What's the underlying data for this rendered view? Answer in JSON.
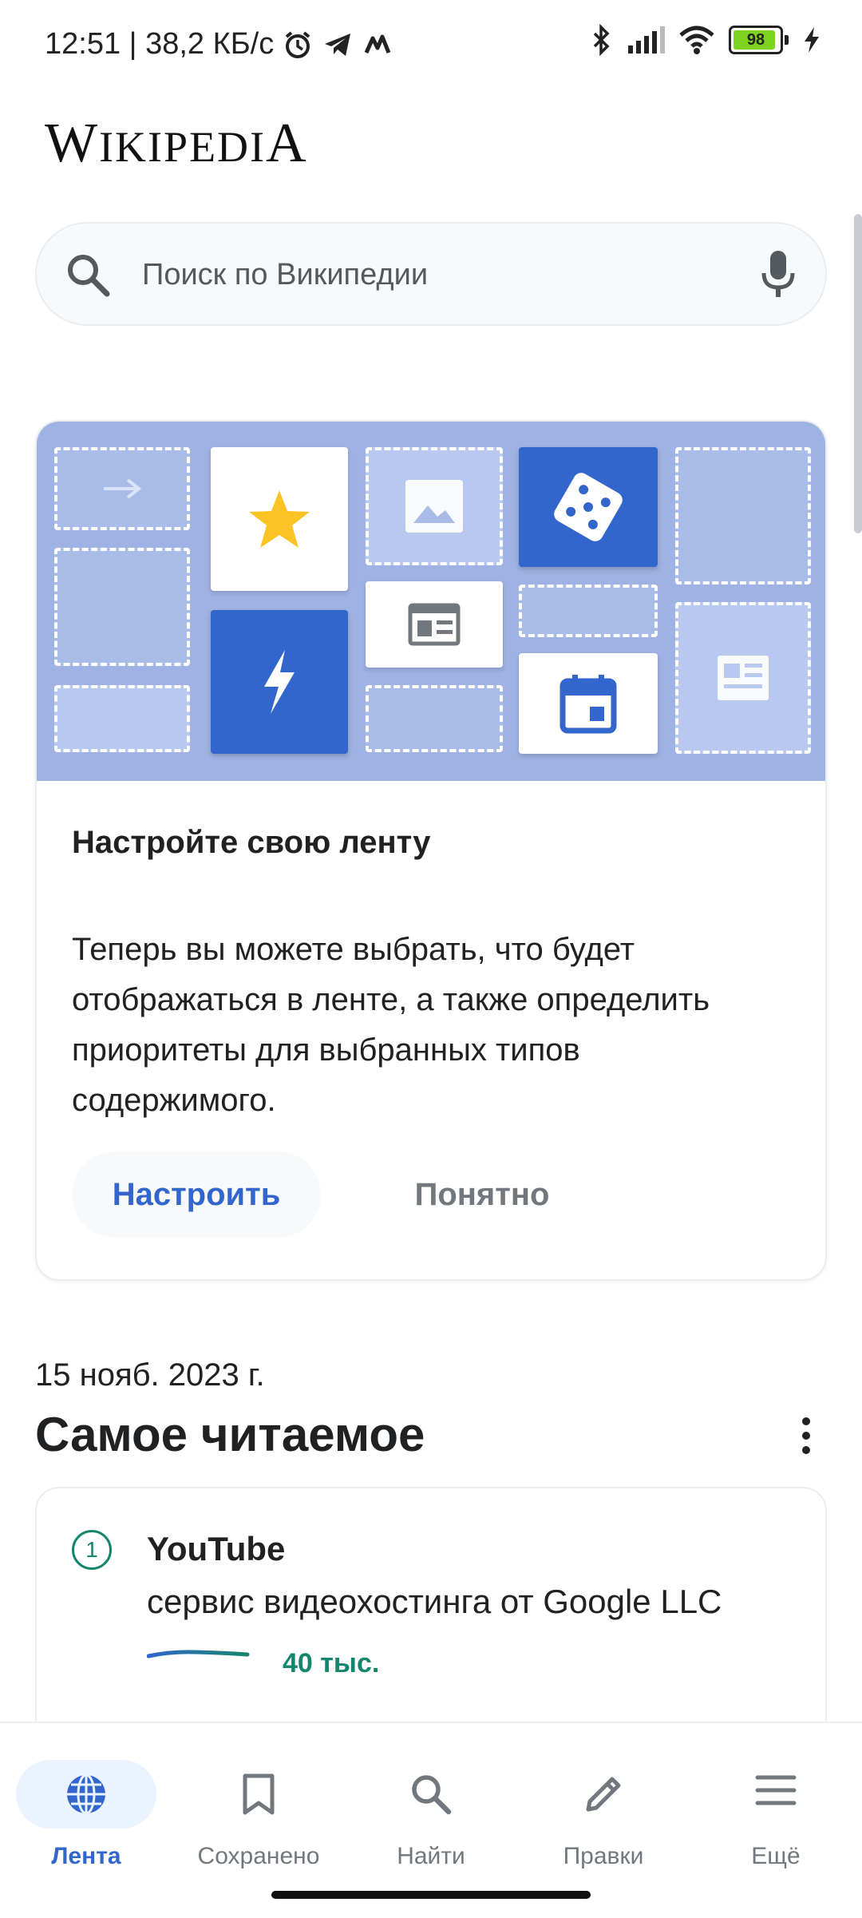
{
  "status_bar": {
    "time_speed": "12:51 | 38,2 КБ/с",
    "battery": "98"
  },
  "logo": {
    "first": "W",
    "rest": "IKIPEDI",
    "last": "A"
  },
  "search": {
    "placeholder": "Поиск по Википедии"
  },
  "card": {
    "title": "Настройте свою ленту",
    "body": "Теперь вы можете выбрать, что будет отображаться в ленте, а также определить приоритеты для выбранных типов содержимого.",
    "primary_button": "Настроить",
    "secondary_button": "Понятно",
    "accent_color": "#3366cc"
  },
  "section": {
    "date": "15 нояб. 2023 г.",
    "title": "Самое читаемое"
  },
  "top_read": [
    {
      "rank": "1",
      "title": "YouTube",
      "description": "сервис видеохостинга от Google LLC",
      "views": "40 тыс."
    }
  ],
  "bottom_nav": {
    "items": [
      {
        "label": "Лента",
        "icon": "globe-icon",
        "active": true
      },
      {
        "label": "Сохранено",
        "icon": "bookmark-icon",
        "active": false
      },
      {
        "label": "Найти",
        "icon": "search-icon",
        "active": false
      },
      {
        "label": "Правки",
        "icon": "pencil-icon",
        "active": false
      },
      {
        "label": "Ещё",
        "icon": "menu-icon",
        "active": false
      }
    ]
  }
}
